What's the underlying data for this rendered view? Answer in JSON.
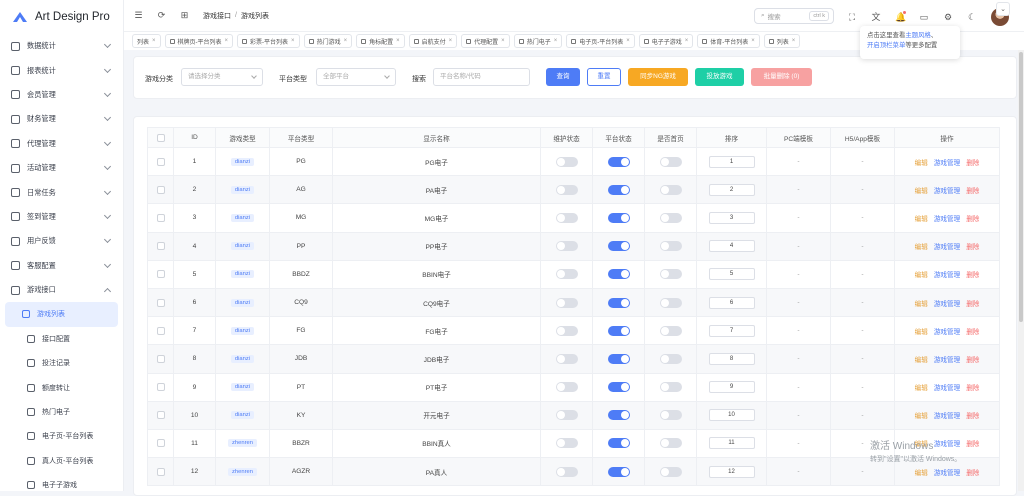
{
  "app": {
    "title": "Art Design Pro"
  },
  "sidebar": {
    "items": [
      {
        "label": "数据统计",
        "icon": "chart-icon"
      },
      {
        "label": "报表统计",
        "icon": "report-icon"
      },
      {
        "label": "会员管理",
        "icon": "user-icon"
      },
      {
        "label": "财务管理",
        "icon": "wallet-icon"
      },
      {
        "label": "代理管理",
        "icon": "agent-icon"
      },
      {
        "label": "活动管理",
        "icon": "gift-icon"
      },
      {
        "label": "日常任务",
        "icon": "calendar-icon"
      },
      {
        "label": "签到管理",
        "icon": "checkin-icon"
      },
      {
        "label": "用户反馈",
        "icon": "feedback-icon"
      },
      {
        "label": "客服配置",
        "icon": "headset-icon"
      },
      {
        "label": "游戏接口",
        "icon": "gamepad-icon"
      }
    ],
    "subitems": [
      {
        "label": "游戏列表",
        "active": true
      },
      {
        "label": "接口配置"
      },
      {
        "label": "投注记录"
      },
      {
        "label": "额度转让"
      },
      {
        "label": "热门电子"
      },
      {
        "label": "电子页-平台列表"
      },
      {
        "label": "真人页-平台列表"
      },
      {
        "label": "电子子游戏"
      }
    ]
  },
  "header": {
    "breadcrumb": [
      "游戏接口",
      "游戏列表"
    ],
    "search_placeholder": "搜索",
    "search_shortcut": "ctrl k"
  },
  "tabs": [
    "列表",
    "棋牌页-平台列表",
    "彩票-平台列表",
    "热门游戏",
    "角标配置",
    "启航支付",
    "代理配置",
    "热门电子",
    "电子页-平台列表",
    "电子子游戏",
    "体育-平台列表",
    "列表"
  ],
  "tooltip": {
    "line1_prefix": "点击这里查看",
    "line1_link": "主题风格",
    "line1_suffix": "、",
    "line2_link": "开启顶栏菜单",
    "line2_suffix": "等更多配置"
  },
  "filter": {
    "category_label": "游戏分类",
    "category_placeholder": "请选择分类",
    "platform_label": "平台类型",
    "platform_value": "全部平台",
    "search_label": "搜索",
    "search_placeholder": "平台名称/代码",
    "btn_query": "查询",
    "btn_reset": "重置",
    "btn_sync": "同步NG游戏",
    "btn_release": "投放游戏",
    "btn_batch_delete": "批量删除 (0)"
  },
  "table": {
    "headers": [
      "ID",
      "游戏类型",
      "平台类型",
      "显示名称",
      "维护状态",
      "平台状态",
      "是否首页",
      "排序",
      "PC端模板",
      "H5/App模板",
      "操作"
    ],
    "action_edit": "编辑",
    "action_manage": "游戏管理",
    "action_delete": "删除",
    "rows": [
      {
        "id": "1",
        "type": "dianzi",
        "platform": "PG",
        "name": "PG电子",
        "maint": false,
        "status": true,
        "home": false,
        "sort": "1",
        "pc": "-",
        "h5": "-"
      },
      {
        "id": "2",
        "type": "dianzi",
        "platform": "AG",
        "name": "PA电子",
        "maint": false,
        "status": true,
        "home": false,
        "sort": "2",
        "pc": "-",
        "h5": "-"
      },
      {
        "id": "3",
        "type": "dianzi",
        "platform": "MG",
        "name": "MG电子",
        "maint": false,
        "status": true,
        "home": false,
        "sort": "3",
        "pc": "-",
        "h5": "-"
      },
      {
        "id": "4",
        "type": "dianzi",
        "platform": "PP",
        "name": "PP电子",
        "maint": false,
        "status": true,
        "home": false,
        "sort": "4",
        "pc": "-",
        "h5": "-"
      },
      {
        "id": "5",
        "type": "dianzi",
        "platform": "BBDZ",
        "name": "BBIN电子",
        "maint": false,
        "status": true,
        "home": false,
        "sort": "5",
        "pc": "-",
        "h5": "-"
      },
      {
        "id": "6",
        "type": "dianzi",
        "platform": "CQ9",
        "name": "CQ9电子",
        "maint": false,
        "status": true,
        "home": false,
        "sort": "6",
        "pc": "-",
        "h5": "-"
      },
      {
        "id": "7",
        "type": "dianzi",
        "platform": "FG",
        "name": "FG电子",
        "maint": false,
        "status": true,
        "home": false,
        "sort": "7",
        "pc": "-",
        "h5": "-"
      },
      {
        "id": "8",
        "type": "dianzi",
        "platform": "JDB",
        "name": "JDB电子",
        "maint": false,
        "status": true,
        "home": false,
        "sort": "8",
        "pc": "-",
        "h5": "-"
      },
      {
        "id": "9",
        "type": "dianzi",
        "platform": "PT",
        "name": "PT电子",
        "maint": false,
        "status": true,
        "home": false,
        "sort": "9",
        "pc": "-",
        "h5": "-"
      },
      {
        "id": "10",
        "type": "dianzi",
        "platform": "KY",
        "name": "开元电子",
        "maint": false,
        "status": true,
        "home": false,
        "sort": "10",
        "pc": "-",
        "h5": "-"
      },
      {
        "id": "11",
        "type": "zhenren",
        "platform": "BBZR",
        "name": "BBIN真人",
        "maint": false,
        "status": true,
        "home": false,
        "sort": "11",
        "pc": "-",
        "h5": "-"
      },
      {
        "id": "12",
        "type": "zhenren",
        "platform": "AGZR",
        "name": "PA真人",
        "maint": false,
        "status": true,
        "home": false,
        "sort": "12",
        "pc": "-",
        "h5": "-"
      }
    ]
  },
  "watermark": {
    "line1": "激活 Windows",
    "line2": "转到\"设置\"以激活 Windows。"
  },
  "colors": {
    "primary": "#4e7cf6",
    "sync": "#f7a823",
    "release": "#1ecfa6",
    "danger_light": "#f7a1a1"
  }
}
